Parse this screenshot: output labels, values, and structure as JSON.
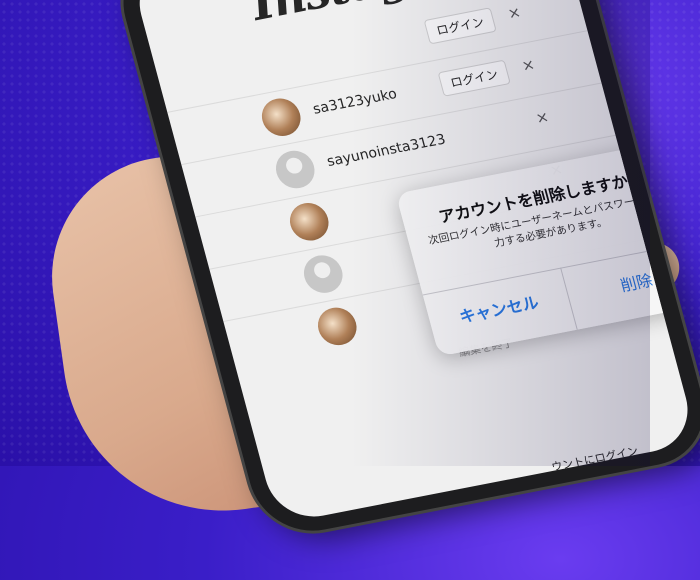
{
  "app": {
    "logo": "Instagram"
  },
  "accounts": [
    {
      "username": "",
      "login_label": "ログイン"
    },
    {
      "username": "sa3123yuko",
      "login_label": "ログイン"
    },
    {
      "username": "sayunoinsta3123",
      "login_label": ""
    },
    {
      "username": "",
      "login_label": ""
    },
    {
      "username": "",
      "login_label": ""
    },
    {
      "username": "",
      "login_label": ""
    }
  ],
  "close_glyph": "×",
  "edit_done": "編集を終了",
  "bottom_link": "ウントにログイン",
  "dialog": {
    "title": "アカウントを削除しますか？",
    "message": "次回ログイン時にユーザーネームとパスワードを入力する必要があります。",
    "cancel": "キャンセル",
    "delete": "削除"
  },
  "colors": {
    "accent": "#2a7ae2",
    "background": "#3a1ec8"
  }
}
